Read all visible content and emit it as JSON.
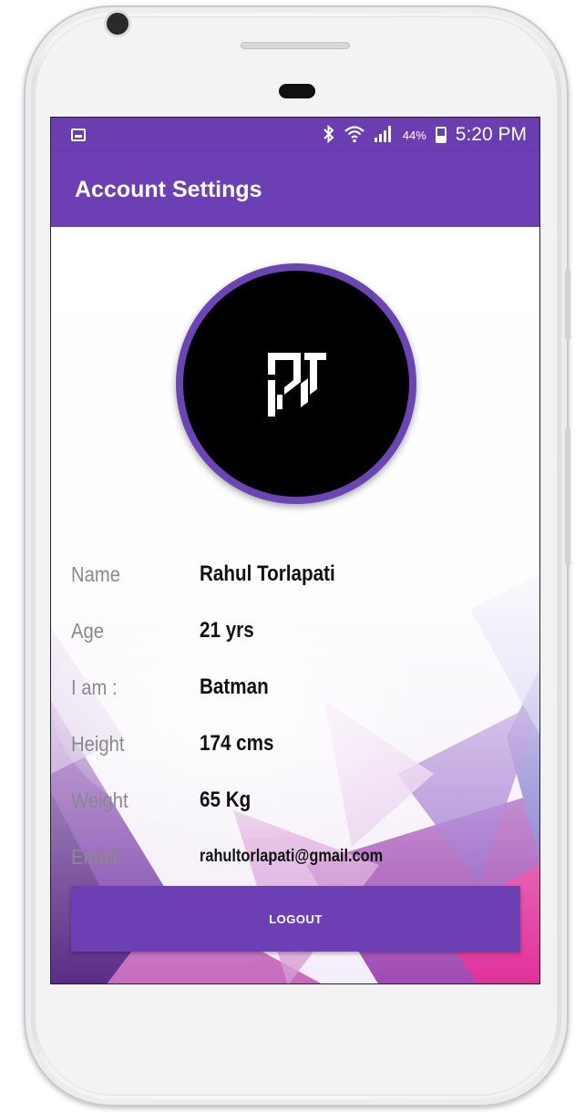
{
  "status_bar": {
    "battery_percent": "44%",
    "time": "5:20 PM",
    "icons": [
      "gallery-notification-icon",
      "bluetooth-icon",
      "wifi-icon",
      "signal-icon",
      "battery-icon"
    ]
  },
  "app_bar": {
    "title": "Account Settings"
  },
  "profile": {
    "avatar_icon": "pt-logo-icon",
    "rows": [
      {
        "label": "Name",
        "value": "Rahul Torlapati"
      },
      {
        "label": "Age",
        "value": "21 yrs"
      },
      {
        "label": "I am :",
        "value": "Batman"
      },
      {
        "label": "Height",
        "value": "174 cms"
      },
      {
        "label": "Weight",
        "value": "65 Kg"
      },
      {
        "label": "Email",
        "value": "rahultorlapati@gmail.com"
      }
    ]
  },
  "actions": {
    "logout_label": "LOGOUT"
  },
  "colors": {
    "primary": "#6c3fb5",
    "status_bar": "#6a3db0",
    "label": "#8a8a8a"
  }
}
